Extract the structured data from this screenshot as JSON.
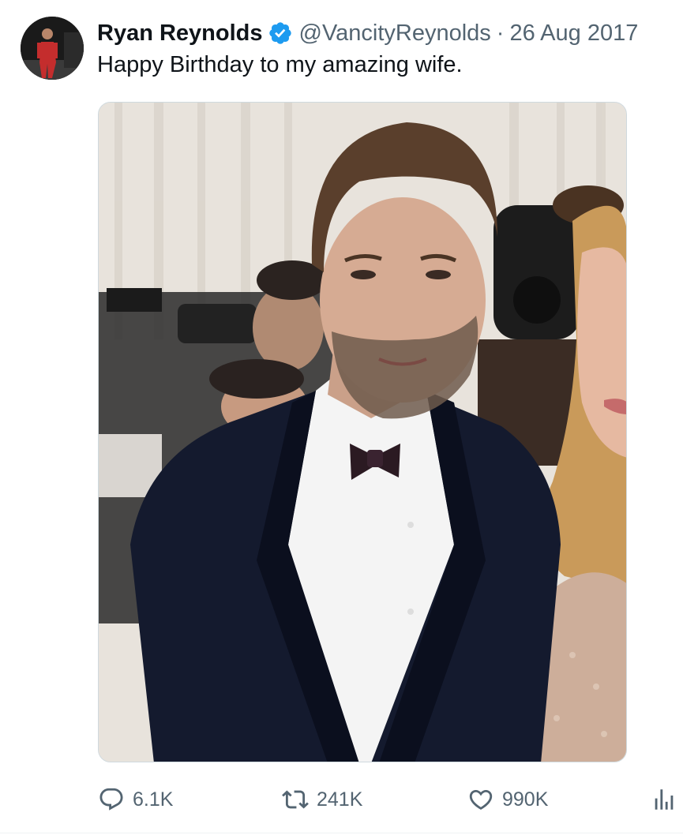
{
  "tweet": {
    "author_name": "Ryan Reynolds",
    "handle": "@VancityReynolds",
    "separator": "·",
    "date": "26 Aug 2017",
    "text": "Happy Birthday to my amazing wife.",
    "verified": true
  },
  "actions": {
    "replies": "6.1K",
    "retweets": "241K",
    "likes": "990K"
  },
  "icons": {
    "verified": "verified-badge-icon",
    "reply": "reply-icon",
    "retweet": "retweet-icon",
    "like": "heart-icon",
    "views": "views-chart-icon"
  },
  "colors": {
    "text_primary": "#0f1419",
    "text_secondary": "#536471",
    "verified_blue": "#1d9bf0"
  }
}
